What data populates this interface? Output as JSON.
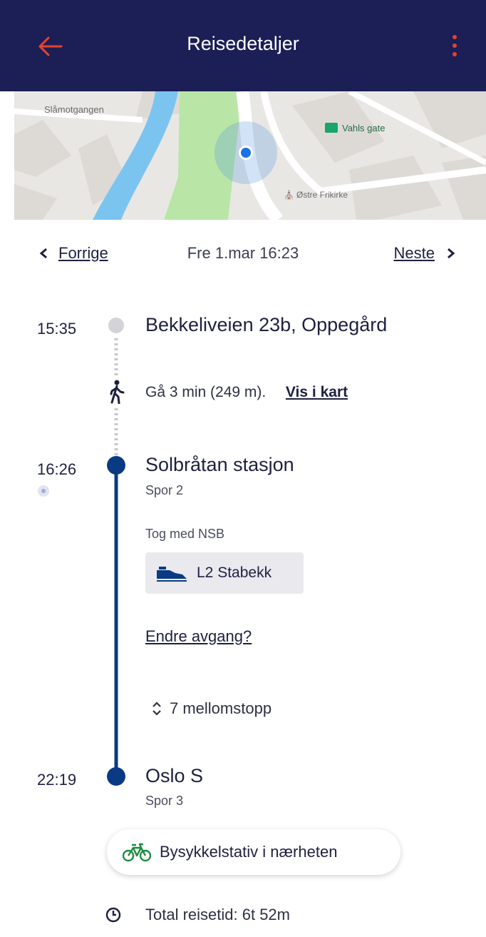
{
  "app_bar": {
    "title": "Reisedetaljer",
    "back_icon": "arrow-left-icon",
    "menu_icon": "more-vertical-icon",
    "accent_color": "#e8412f",
    "background_color": "#1b1f55"
  },
  "map": {
    "labels": {
      "street": "Slåmotgangen",
      "bus_stop": "Vahls gate",
      "church": "Østre Frikirke"
    }
  },
  "navigation": {
    "prev_label": "Forrige",
    "next_label": "Neste",
    "date": "Fre 1.mar 16:23"
  },
  "trip": {
    "origin": {
      "time": "15:35",
      "name": "Bekkeliveien 23b, Oppegård"
    },
    "walk": {
      "text": "Gå 3 min (249 m).",
      "link": "Vis i kart"
    },
    "boarding": {
      "time": "16:26",
      "name": "Solbråtan stasjon",
      "platform": "Spor 2",
      "operator": "Tog med NSB",
      "line_label": "L2 Stabekk",
      "change_departure": "Endre avgang?",
      "intermediate_stops": "7 mellomstopp"
    },
    "destination": {
      "time": "22:19",
      "name": "Oslo S",
      "platform": "Spor 3"
    },
    "bike_button": "Bysykkelstativ i nærheten",
    "total": "Total reisetid: 6t 52m",
    "line_color": "#0b3a84"
  }
}
